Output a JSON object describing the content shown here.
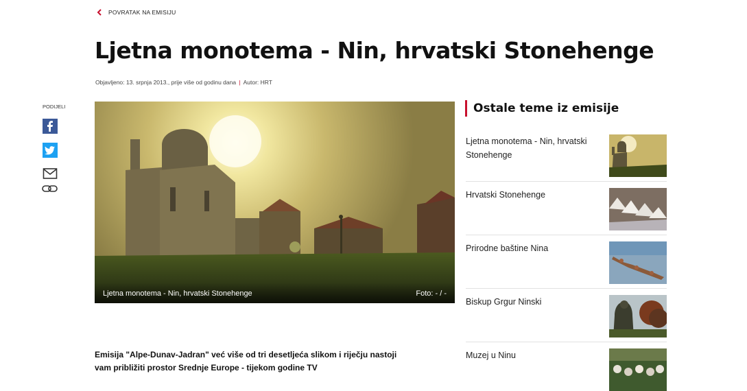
{
  "back_link": "POVRATAK NA EMISIJU",
  "article": {
    "title": "Ljetna monotema - Nin, hrvatski Stonehenge",
    "published": "Objavljeno: 13. srpnja 2013., prije više od godinu dana",
    "separator": "|",
    "author": "Autor: HRT",
    "image_caption": "Ljetna monotema - Nin, hrvatski Stonehenge",
    "photo_credit": "Foto: - / -",
    "intro": "Emisija \"Alpe-Dunav-Jadran\" već više od tri desetljeća slikom i riječju nastoji vam približiti prostor Srednje Europe - tijekom godine TV"
  },
  "share": {
    "label": "PODIJELI",
    "icons": [
      "facebook-icon",
      "twitter-icon",
      "mail-icon",
      "link-icon"
    ]
  },
  "sidebar": {
    "heading": "Ostale teme iz emisije",
    "items": [
      {
        "title": "Ljetna monotema - Nin, hrvatski Stonehenge"
      },
      {
        "title": "Hrvatski Stonehenge"
      },
      {
        "title": "Prirodne baštine Nina"
      },
      {
        "title": "Biskup Grgur Ninski"
      },
      {
        "title": "Muzej u Ninu"
      }
    ]
  },
  "colors": {
    "accent": "#c8102e",
    "facebook": "#3b5998",
    "twitter": "#1da1f2"
  }
}
